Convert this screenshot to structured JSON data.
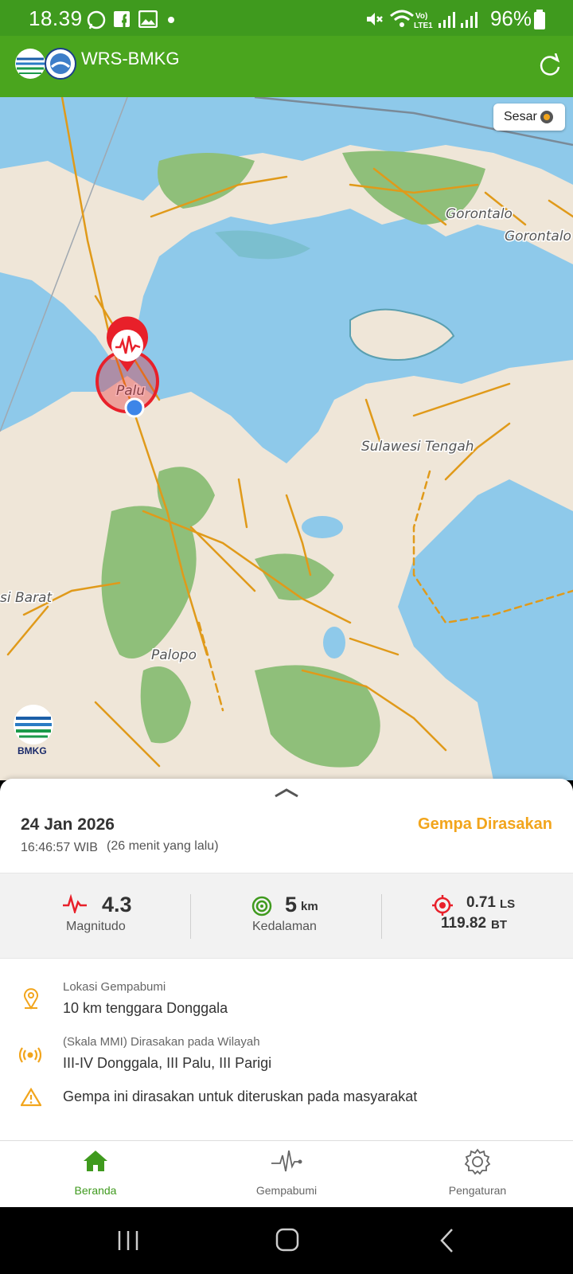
{
  "status_bar": {
    "time": "18.39",
    "battery": "96%",
    "notification_icons": [
      "whatsapp-icon",
      "facebook-icon",
      "gallery-icon",
      "dot-icon"
    ],
    "system_icons": [
      "mute-icon",
      "wifi-icon",
      "volte-lte-icon",
      "signal-icon",
      "signal-icon",
      "battery-icon"
    ]
  },
  "app_bar": {
    "title": "WRS-BMKG",
    "refresh_icon": "refresh-icon"
  },
  "map": {
    "layer_toggle_label": "Sesar",
    "labels": {
      "gorontalo_region": "Gorontalo",
      "gorontalo_city": "Gorontalo",
      "palu": "Palu",
      "sulawesi_tengah": "Sulawesi Tengah",
      "sulawesi_barat_partial": "si Barat",
      "palopo": "Palopo"
    },
    "watermark": "BMKG",
    "colors": {
      "sea": "#8ec9ea",
      "land": "#efe6d8",
      "forest": "#8fbf7a",
      "fault": "#e09a1a",
      "epicenter": "#e8202a"
    }
  },
  "event": {
    "date": "24 Jan 2026",
    "time": "16:46:57 WIB",
    "ago": "(26 menit yang lalu)",
    "status": "Gempa Dirasakan",
    "magnitude": {
      "value": "4.3",
      "label": "Magnitudo"
    },
    "depth": {
      "value": "5",
      "unit": "km",
      "label": "Kedalaman"
    },
    "coordinates": {
      "lat": "0.71",
      "lat_unit": "LS",
      "lon": "119.82",
      "lon_unit": "BT"
    },
    "location": {
      "label": "Lokasi Gempabumi",
      "value": "10 km tenggara Donggala"
    },
    "felt": {
      "label": "(Skala MMI) Dirasakan pada Wilayah",
      "value": "III-IV Donggala, III Palu, III Parigi"
    },
    "warning": "Gempa ini dirasakan untuk diteruskan pada masyarakat"
  },
  "bottom_nav": {
    "items": [
      {
        "label": "Beranda",
        "icon": "home-icon",
        "active": true
      },
      {
        "label": "Gempabumi",
        "icon": "seismograph-icon",
        "active": false
      },
      {
        "label": "Pengaturan",
        "icon": "gear-icon",
        "active": false
      }
    ],
    "active_color": "#3f9a1e"
  }
}
